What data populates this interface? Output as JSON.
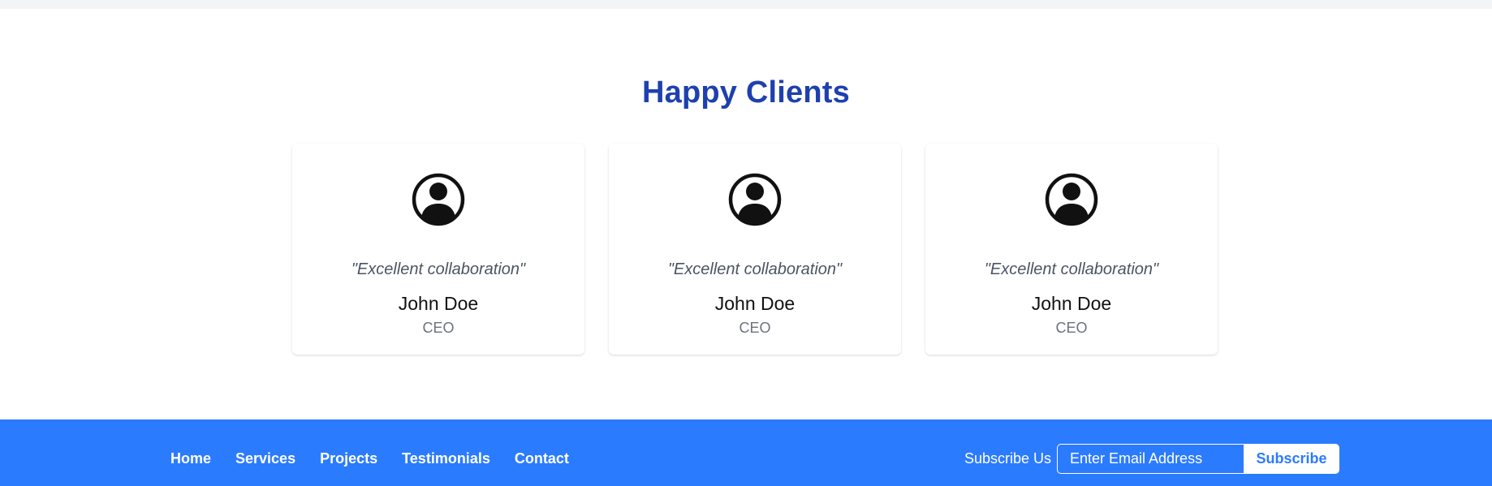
{
  "testimonials": {
    "title": "Happy Clients",
    "cards": [
      {
        "quote": "\"Excellent collaboration\"",
        "name": "John Doe",
        "role": "CEO",
        "icon": "user-circle-icon"
      },
      {
        "quote": "\"Excellent collaboration\"",
        "name": "John Doe",
        "role": "CEO",
        "icon": "user-circle-icon"
      },
      {
        "quote": "\"Excellent collaboration\"",
        "name": "John Doe",
        "role": "CEO",
        "icon": "user-circle-icon"
      }
    ]
  },
  "footer": {
    "nav": [
      "Home",
      "Services",
      "Projects",
      "Testimonials",
      "Contact"
    ],
    "subscribe_label": "Subscribe Us",
    "email_placeholder": "Enter Email Address",
    "subscribe_button": "Subscribe"
  },
  "colors": {
    "title": "#1e40af",
    "footer_bg": "#2b7bff",
    "top_strip": "#f3f4f6"
  }
}
